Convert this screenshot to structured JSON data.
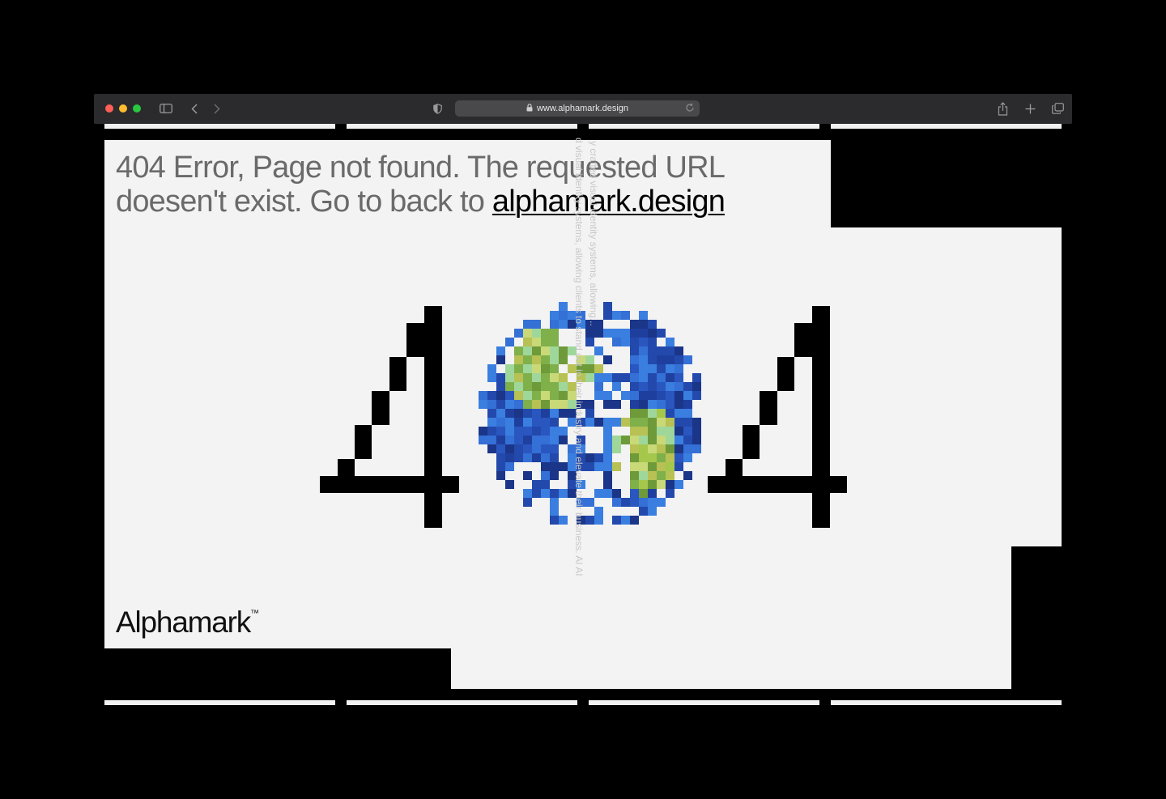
{
  "browser": {
    "url": "www.alphamark.design",
    "icons": {
      "sidebar": "sidebar-icon",
      "back": "chevron-left-icon",
      "forward": "chevron-right-icon",
      "privacy": "shield-icon",
      "lock": "lock-icon",
      "reload": "reload-icon",
      "share": "share-icon",
      "new_tab": "plus-icon",
      "tabs": "tabs-overview-icon"
    }
  },
  "page": {
    "error_prefix": "404 Error, Page not found. The requested URL doesen't exist. Go to back to ",
    "home_link": "alphamark.design",
    "brand_name": "Alphamark",
    "brand_mark": "™",
    "vertical_text_1": "y crafted visual identity systems, allowing...",
    "vertical_text_2": "d visual identity systems, allowing clients to stand out in their industry and elevate their business. AI AI",
    "hero_number": "404"
  },
  "colors": {
    "background": "#000000",
    "page": "#f3f3f3",
    "text_muted": "#6a6a6a",
    "digit": "#000000",
    "ocean": "#2a56c0",
    "land": "#7fb04a"
  }
}
